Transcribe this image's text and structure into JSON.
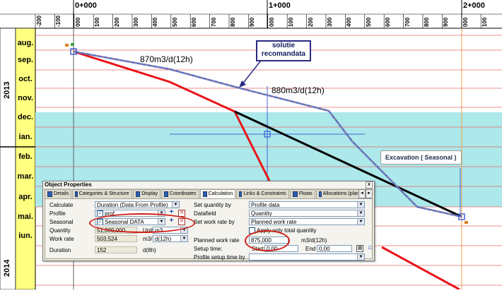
{
  "ruler": {
    "major": [
      "0+000",
      "1+000",
      "2+000"
    ],
    "minor": [
      "-200",
      "-100",
      "000",
      "100",
      "200",
      "300",
      "400",
      "500",
      "600",
      "700",
      "800",
      "900",
      "000",
      "100",
      "200",
      "300",
      "400",
      "500",
      "600",
      "700",
      "800",
      "900",
      "000",
      "100"
    ]
  },
  "years": [
    "2013",
    "2014"
  ],
  "months": [
    "aug.",
    "sep.",
    "oct.",
    "nov.",
    "dec.",
    "ian.",
    "feb.",
    "mar.",
    "apr.",
    "mai.",
    "iun."
  ],
  "annotations": {
    "rate1": "870m3/d(12h)",
    "rate2": "880m3/d(12h)",
    "callout_recommended": "solutie recomandata",
    "callout_excavation": "Excavation ( Seasonal )"
  },
  "colors": {
    "highlight_band": "#ade8ea",
    "red_line": "#e8141a",
    "black_line": "#000000",
    "blue_line": "#5a6fc8",
    "grid_red": "#e46a6a",
    "orange_line": "#f0a040",
    "month_bg": "#ffff80"
  },
  "dialog": {
    "title": "Object Properties",
    "close": "x",
    "tabs": [
      "Details",
      "Categories & Structure",
      "Display",
      "Coordinates",
      "Calculation",
      "Links & Constraints",
      "Floats",
      "Allocations (planned)"
    ],
    "active_tab": "Calculation",
    "left": {
      "calculate_label": "Calculate",
      "calculate_value": "Duration (Data From Profile)",
      "profile_label": "Profile",
      "profile_value": "prof",
      "seasonal_label": "Seasonal",
      "seasonal_value": "Seasonal DATA",
      "quantity_label": "Quantity",
      "quantity_value": "51,000,000",
      "unit_label": "Unit",
      "unit_value": "m3",
      "work_rate_label": "Work rate",
      "work_rate_value": "503,524",
      "work_rate_unit": "m3/",
      "work_rate_unit2": "d(12h)",
      "duration_label": "Duration",
      "duration_value": "152",
      "duration_unit": "d(8h)"
    },
    "right": {
      "set_quantity_label": "Set quantity by",
      "set_quantity_value": "Profile data",
      "datafield_label": "Datafield",
      "datafield_value": "Quantity",
      "set_work_rate_label": "Set work rate by",
      "set_work_rate_value": "Planned work rate",
      "apply_label": "Apply only total quantity",
      "planned_rate_label": "Planned work rate",
      "planned_rate_value": "875,000",
      "planned_rate_unit": "m3/d(12h)",
      "setup_time_label": "Setup time:",
      "start_label": "Start",
      "start_value": "0,00",
      "end_label": "End",
      "end_value": "0,00",
      "profile_setup_label": "Profile setup time by",
      "profile_setup_value": ""
    }
  }
}
